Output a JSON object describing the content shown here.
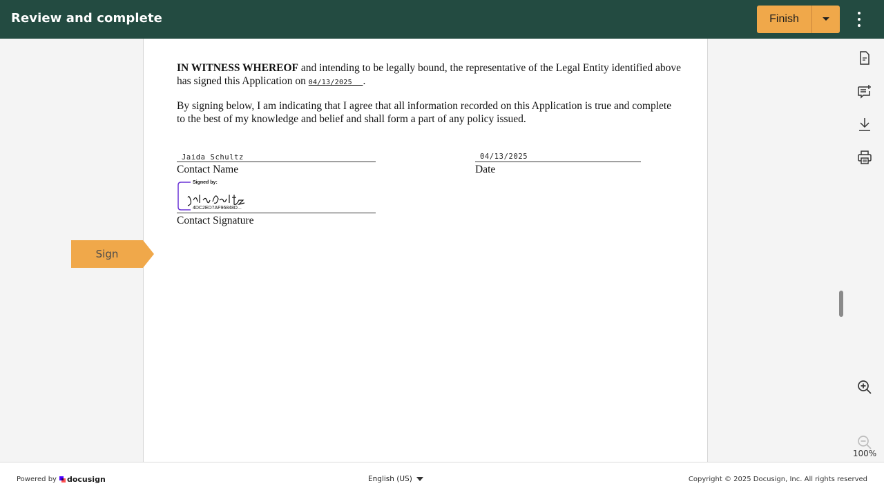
{
  "header": {
    "title": "Review and complete",
    "finish_label": "Finish",
    "background_color": "#234b41",
    "accent_color": "#f0a84a"
  },
  "document": {
    "paragraph1": {
      "bold_lead": "IN WITNESS WHEREOF",
      "text": " and intending to be legally bound, the representative of the Legal Entity identified above has signed this Application on ",
      "date": "04/13/2025",
      "end": "."
    },
    "paragraph2": "By signing below, I am indicating that I agree that all information recorded on this Application is true and complete to the best of my knowledge and belief and shall form a part of any policy issued.",
    "contact_name_value": "Jaida Schultz",
    "contact_name_label": "Contact Name",
    "date_value": "04/13/2025",
    "date_label": "Date",
    "signature": {
      "signed_by_label": "Signed by:",
      "signature_text": "Jaida Schultz",
      "envelope_id": "4DC2ED7AF96848D..."
    },
    "contact_signature_label": "Contact Signature"
  },
  "sign_tag": {
    "label": "Sign"
  },
  "tools": {
    "icons": [
      "document-icon",
      "add-comment-icon",
      "download-icon",
      "print-icon",
      "zoom-in-icon",
      "zoom-out-icon"
    ],
    "zoom_level": "100%"
  },
  "footer": {
    "powered_by": "Powered by",
    "brand": "docusign",
    "language": "English (US)",
    "copyright": "Copyright © 2025 Docusign, Inc. All rights reserved"
  }
}
